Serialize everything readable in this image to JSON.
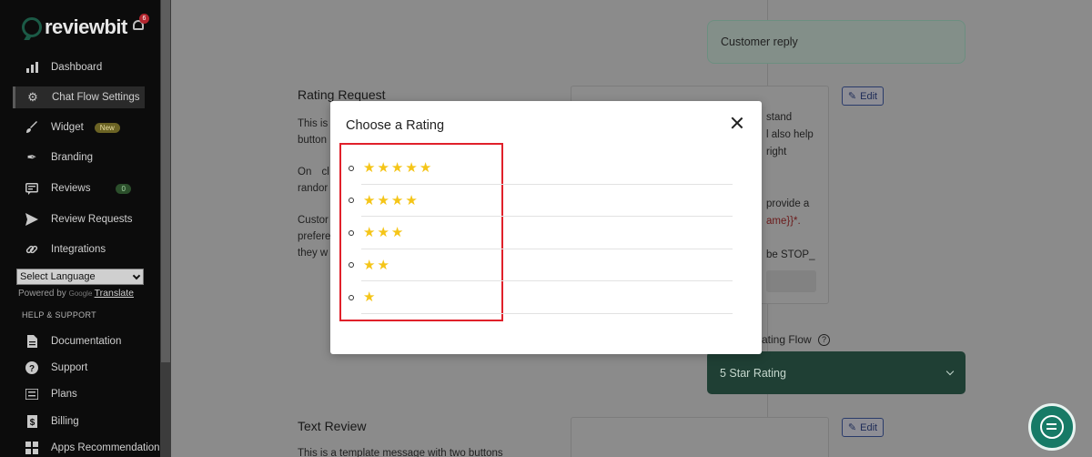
{
  "brand": {
    "name": "reviewbit",
    "notification_count": "6"
  },
  "sidebar": {
    "items": [
      {
        "label": "Dashboard",
        "icon": "bar-chart-icon"
      },
      {
        "label": "Chat Flow Settings",
        "icon": "gear-icon",
        "active": true
      },
      {
        "label": "Widget",
        "icon": "brush-icon",
        "badge": "New"
      },
      {
        "label": "Branding",
        "icon": "pen-nib-icon"
      },
      {
        "label": "Reviews",
        "icon": "reviews-icon",
        "badge": "0"
      },
      {
        "label": "Review Requests",
        "icon": "send-icon"
      },
      {
        "label": "Integrations",
        "icon": "link-icon"
      }
    ],
    "language_select": "Select Language",
    "powered_by": "Powered by",
    "translate": "Translate",
    "help_section": "HELP & SUPPORT",
    "help_items": [
      {
        "label": "Documentation",
        "icon": "document-icon"
      },
      {
        "label": "Support",
        "icon": "question-icon"
      },
      {
        "label": "Plans",
        "icon": "list-icon"
      },
      {
        "label": "Billing",
        "icon": "dollar-icon"
      },
      {
        "label": "Apps Recommendation",
        "icon": "apps-icon"
      }
    ]
  },
  "page": {
    "customer_reply": "Customer reply",
    "rating_request": {
      "title": "Rating Request",
      "text_lines": [
        "This is",
        "button",
        "On cl",
        "randor",
        "Custor",
        "prefere",
        "they w"
      ],
      "preview_lines": [
        "stand",
        "l also help",
        "right",
        "provide a",
        "ame}}*.",
        "be STOP_"
      ],
      "edit": "Edit"
    },
    "rating_flow_label": "ating Flow",
    "rating_flow_select": "5 Star Rating",
    "text_review": {
      "title": "Text Review",
      "text": "This is a template message with two buttons",
      "edit": "Edit"
    }
  },
  "modal": {
    "title": "Choose a Rating",
    "ratings": [
      5,
      4,
      3,
      2,
      1
    ],
    "star_color": "#f5c518",
    "highlight_color": "#e0202a"
  }
}
